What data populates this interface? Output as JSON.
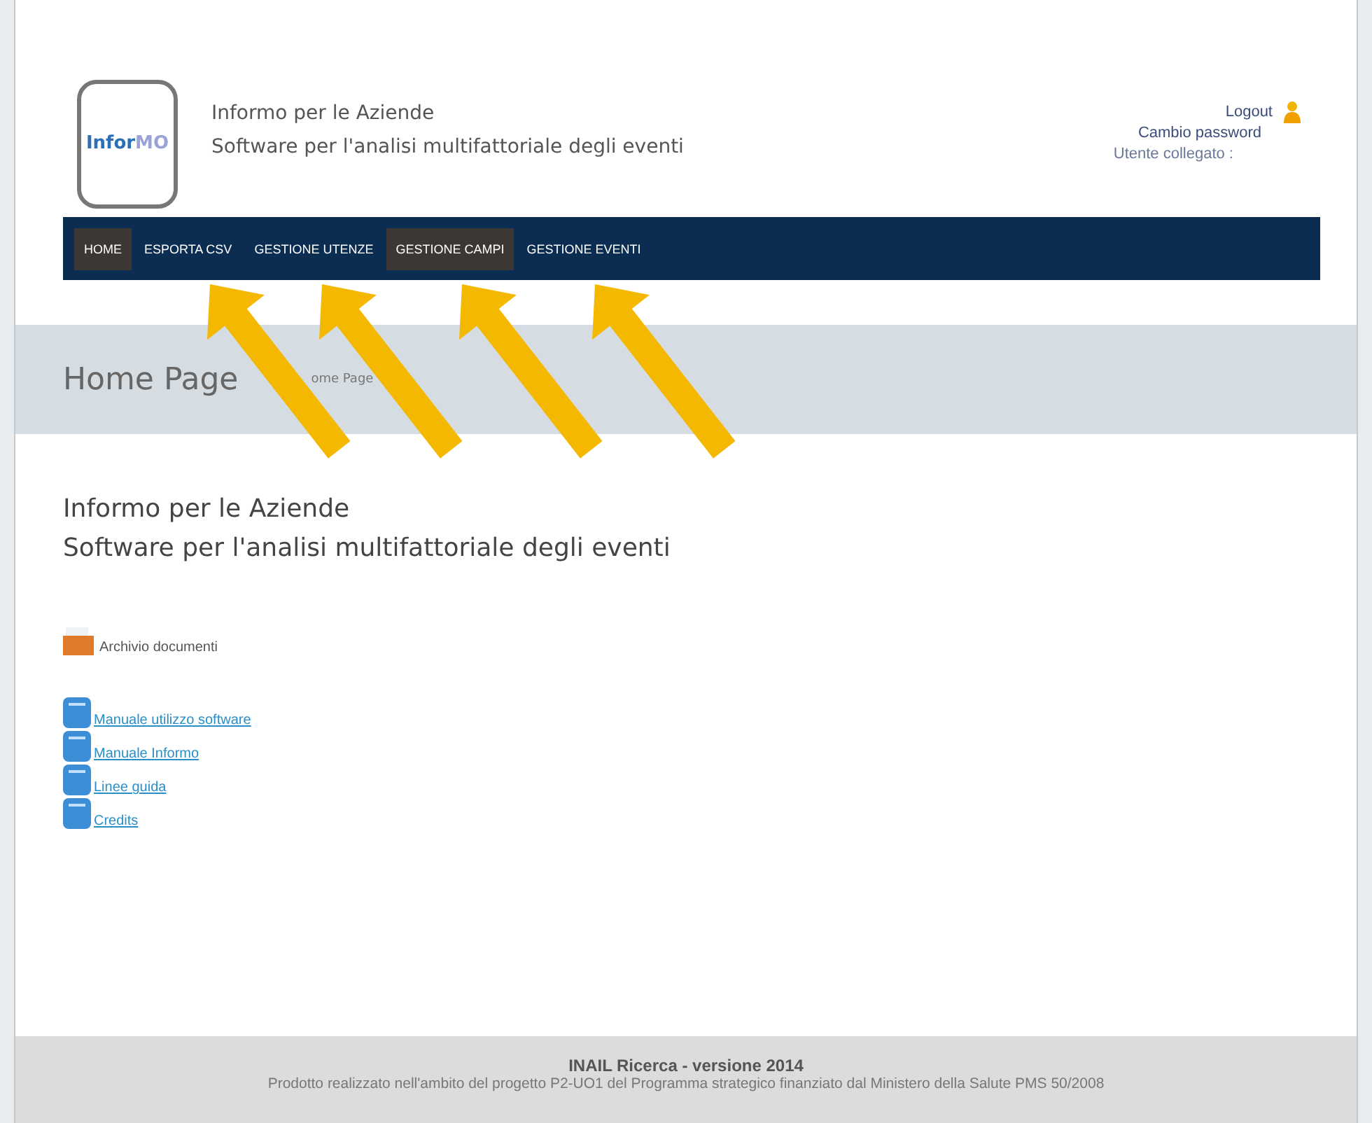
{
  "header": {
    "logo_text": "Infor",
    "logo_text_accent": "MO",
    "title": "Informo per le Aziende",
    "subtitle": "Software per l'analisi multifattoriale degli eventi",
    "user_links": [
      {
        "label": "Logout",
        "kind": "link"
      },
      {
        "label": "Cambio password",
        "kind": "link"
      },
      {
        "label": "Utente collegato :",
        "kind": "text"
      }
    ]
  },
  "nav": [
    {
      "label": "HOME",
      "selected": true
    },
    {
      "label": "ESPORTA CSV",
      "selected": false
    },
    {
      "label": "GESTIONE UTENZE",
      "selected": false
    },
    {
      "label": "GESTIONE CAMPI",
      "selected": true
    },
    {
      "label": "GESTIONE EVENTI",
      "selected": false
    }
  ],
  "page_band": {
    "title": "Home Page",
    "breadcrumb": "ome Page"
  },
  "content": {
    "title": "Informo per le Aziende",
    "subtitle": "Software per l'analisi multifattoriale degli eventi",
    "archive": "Archivio documenti",
    "documents": [
      "Manuale utilizzo software",
      "Manuale Informo",
      "Linee guida",
      "Credits"
    ]
  },
  "footer": {
    "title": "INAIL Ricerca - versione 2014",
    "text": "Prodotto realizzato nell'ambito del progetto P2-UO1 del Programma strategico finanziato dal Ministero della Salute PMS 50/2008"
  }
}
